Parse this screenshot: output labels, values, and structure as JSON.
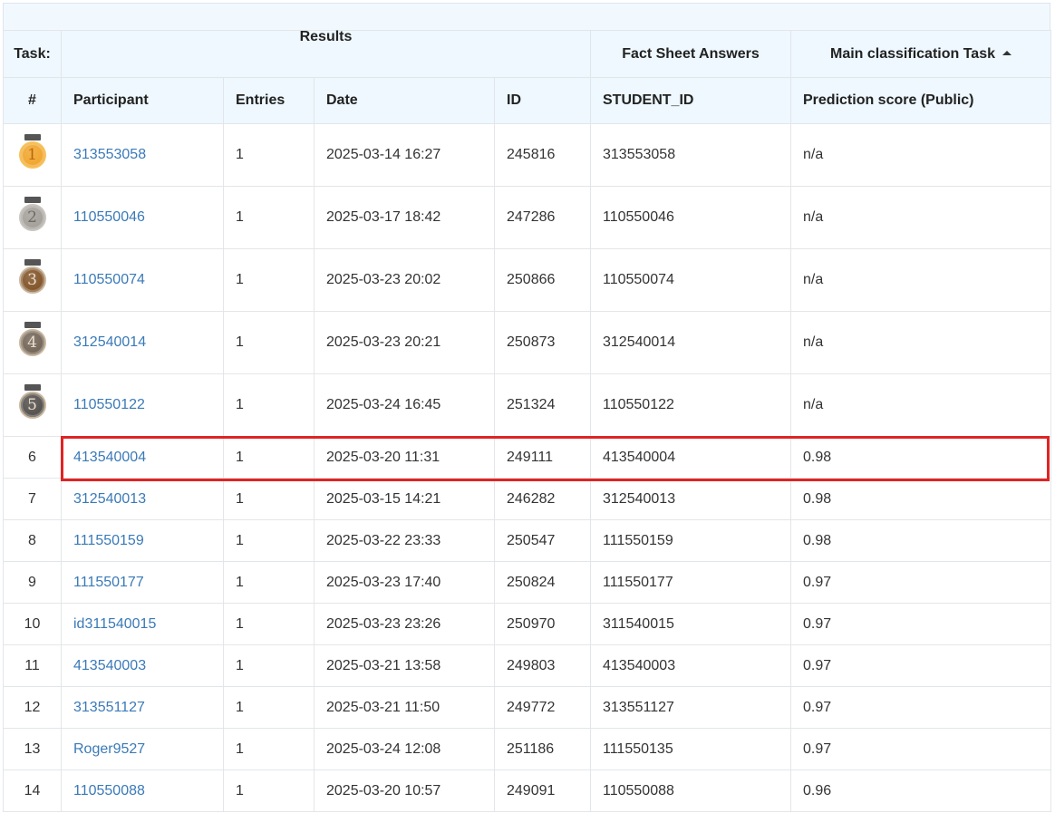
{
  "header": {
    "task_label": "Task:",
    "results_label": "Results",
    "fact_sheet_label": "Fact Sheet Answers",
    "main_task_label": "Main classification Task"
  },
  "columns": [
    "#",
    "Participant",
    "Entries",
    "Date",
    "ID",
    "STUDENT_ID",
    "Prediction score (Public)"
  ],
  "medal_colors": {
    "gold": "#f0a020",
    "silver": "#9e9a94",
    "bronze": "#7a4a1c",
    "fourth": "#6b5d4e",
    "fifth": "#4a4642"
  },
  "rows": [
    {
      "rank": "1",
      "participant": "313553058",
      "entries": "1",
      "date": "2025-03-14 16:27",
      "id": "245816",
      "student_id": "313553058",
      "score": "n/a",
      "medal": "gold"
    },
    {
      "rank": "2",
      "participant": "110550046",
      "entries": "1",
      "date": "2025-03-17 18:42",
      "id": "247286",
      "student_id": "110550046",
      "score": "n/a",
      "medal": "silver"
    },
    {
      "rank": "3",
      "participant": "110550074",
      "entries": "1",
      "date": "2025-03-23 20:02",
      "id": "250866",
      "student_id": "110550074",
      "score": "n/a",
      "medal": "bronze"
    },
    {
      "rank": "4",
      "participant": "312540014",
      "entries": "1",
      "date": "2025-03-23 20:21",
      "id": "250873",
      "student_id": "312540014",
      "score": "n/a",
      "medal": "fourth"
    },
    {
      "rank": "5",
      "participant": "110550122",
      "entries": "1",
      "date": "2025-03-24 16:45",
      "id": "251324",
      "student_id": "110550122",
      "score": "n/a",
      "medal": "fifth"
    },
    {
      "rank": "6",
      "participant": "413540004",
      "entries": "1",
      "date": "2025-03-20 11:31",
      "id": "249111",
      "student_id": "413540004",
      "score": "0.98"
    },
    {
      "rank": "7",
      "participant": "312540013",
      "entries": "1",
      "date": "2025-03-15 14:21",
      "id": "246282",
      "student_id": "312540013",
      "score": "0.98"
    },
    {
      "rank": "8",
      "participant": "111550159",
      "entries": "1",
      "date": "2025-03-22 23:33",
      "id": "250547",
      "student_id": "111550159",
      "score": "0.98"
    },
    {
      "rank": "9",
      "participant": "111550177",
      "entries": "1",
      "date": "2025-03-23 17:40",
      "id": "250824",
      "student_id": "111550177",
      "score": "0.97"
    },
    {
      "rank": "10",
      "participant": "id311540015",
      "entries": "1",
      "date": "2025-03-23 23:26",
      "id": "250970",
      "student_id": "311540015",
      "score": "0.97"
    },
    {
      "rank": "11",
      "participant": "413540003",
      "entries": "1",
      "date": "2025-03-21 13:58",
      "id": "249803",
      "student_id": "413540003",
      "score": "0.97"
    },
    {
      "rank": "12",
      "participant": "313551127",
      "entries": "1",
      "date": "2025-03-21 11:50",
      "id": "249772",
      "student_id": "313551127",
      "score": "0.97"
    },
    {
      "rank": "13",
      "participant": "Roger9527",
      "entries": "1",
      "date": "2025-03-24 12:08",
      "id": "251186",
      "student_id": "111550135",
      "score": "0.97"
    },
    {
      "rank": "14",
      "participant": "110550088",
      "entries": "1",
      "date": "2025-03-20 10:57",
      "id": "249091",
      "student_id": "110550088",
      "score": "0.96"
    }
  ],
  "highlight_color": "#e02424"
}
